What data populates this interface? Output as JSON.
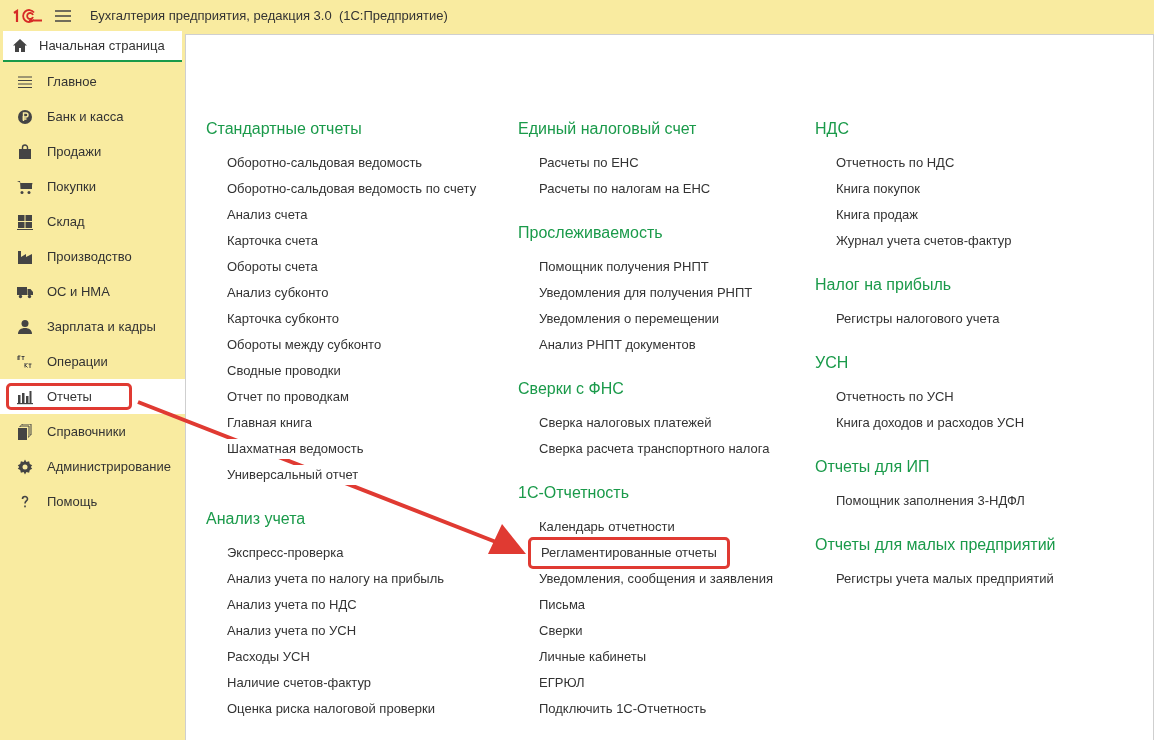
{
  "window": {
    "title": "Бухгалтерия предприятия, редакция 3.0  (1С:Предприятие)"
  },
  "home_tab": {
    "label": "Начальная страница",
    "selected": true
  },
  "sidebar": {
    "items": [
      {
        "label": "Главное",
        "selected": false,
        "highlighted": false
      },
      {
        "label": "Банк и касса",
        "selected": false,
        "highlighted": false
      },
      {
        "label": "Продажи",
        "selected": false,
        "highlighted": false
      },
      {
        "label": "Покупки",
        "selected": false,
        "highlighted": false
      },
      {
        "label": "Склад",
        "selected": false,
        "highlighted": false
      },
      {
        "label": "Производство",
        "selected": false,
        "highlighted": false
      },
      {
        "label": "ОС и НМА",
        "selected": false,
        "highlighted": false
      },
      {
        "label": "Зарплата и кадры",
        "selected": false,
        "highlighted": false
      },
      {
        "label": "Операции",
        "selected": false,
        "highlighted": false
      },
      {
        "label": "Отчеты",
        "selected": true,
        "highlighted": true
      },
      {
        "label": "Справочники",
        "selected": false,
        "highlighted": false
      },
      {
        "label": "Администрирование",
        "selected": false,
        "highlighted": false
      },
      {
        "label": "Помощь",
        "selected": false,
        "highlighted": false
      }
    ]
  },
  "columns": [
    [
      {
        "title": "Стандартные отчеты",
        "links": [
          {
            "label": "Оборотно-сальдовая ведомость",
            "highlighted": false
          },
          {
            "label": "Оборотно-сальдовая ведомость по счету",
            "highlighted": false
          },
          {
            "label": "Анализ счета",
            "highlighted": false
          },
          {
            "label": "Карточка счета",
            "highlighted": false
          },
          {
            "label": "Обороты счета",
            "highlighted": false
          },
          {
            "label": "Анализ субконто",
            "highlighted": false
          },
          {
            "label": "Карточка субконто",
            "highlighted": false
          },
          {
            "label": "Обороты между субконто",
            "highlighted": false
          },
          {
            "label": "Сводные проводки",
            "highlighted": false
          },
          {
            "label": "Отчет по проводкам",
            "highlighted": false
          },
          {
            "label": "Главная книга",
            "highlighted": false
          },
          {
            "label": "Шахматная ведомость",
            "highlighted": false
          },
          {
            "label": "Универсальный отчет",
            "highlighted": false
          }
        ]
      },
      {
        "title": "Анализ учета",
        "links": [
          {
            "label": "Экспресс-проверка",
            "highlighted": false
          },
          {
            "label": "Анализ учета по налогу на прибыль",
            "highlighted": false
          },
          {
            "label": "Анализ учета по НДС",
            "highlighted": false
          },
          {
            "label": "Анализ учета по УСН",
            "highlighted": false
          },
          {
            "label": "Расходы УСН",
            "highlighted": false
          },
          {
            "label": "Наличие счетов-фактур",
            "highlighted": false
          },
          {
            "label": "Оценка риска налоговой проверки",
            "highlighted": false
          }
        ]
      }
    ],
    [
      {
        "title": "Единый налоговый счет",
        "links": [
          {
            "label": "Расчеты по ЕНС",
            "highlighted": false
          },
          {
            "label": "Расчеты по налогам на ЕНС",
            "highlighted": false
          }
        ]
      },
      {
        "title": "Прослеживаемость",
        "links": [
          {
            "label": "Помощник получения РНПТ",
            "highlighted": false
          },
          {
            "label": "Уведомления для получения РНПТ",
            "highlighted": false
          },
          {
            "label": "Уведомления о перемещении",
            "highlighted": false
          },
          {
            "label": "Анализ РНПТ документов",
            "highlighted": false
          }
        ]
      },
      {
        "title": "Сверки с ФНС",
        "links": [
          {
            "label": "Сверка налоговых платежей",
            "highlighted": false
          },
          {
            "label": "Сверка расчета транспортного налога",
            "highlighted": false
          }
        ]
      },
      {
        "title": "1С-Отчетность",
        "links": [
          {
            "label": "Календарь отчетности",
            "highlighted": false
          },
          {
            "label": "Регламентированные отчеты",
            "highlighted": true
          },
          {
            "label": "Уведомления, сообщения и заявления",
            "highlighted": false
          },
          {
            "label": "Письма",
            "highlighted": false
          },
          {
            "label": "Сверки",
            "highlighted": false
          },
          {
            "label": "Личные кабинеты",
            "highlighted": false
          },
          {
            "label": "ЕГРЮЛ",
            "highlighted": false
          },
          {
            "label": "Подключить 1С-Отчетность",
            "highlighted": false
          }
        ]
      }
    ],
    [
      {
        "title": "НДС",
        "links": [
          {
            "label": "Отчетность по НДС",
            "highlighted": false
          },
          {
            "label": "Книга покупок",
            "highlighted": false
          },
          {
            "label": "Книга продаж",
            "highlighted": false
          },
          {
            "label": "Журнал учета счетов-фактур",
            "highlighted": false
          }
        ]
      },
      {
        "title": "Налог на прибыль",
        "links": [
          {
            "label": "Регистры налогового учета",
            "highlighted": false
          }
        ]
      },
      {
        "title": "УСН",
        "links": [
          {
            "label": "Отчетность по УСН",
            "highlighted": false
          },
          {
            "label": "Книга доходов и расходов УСН",
            "highlighted": false
          }
        ]
      },
      {
        "title": "Отчеты для ИП",
        "links": [
          {
            "label": "Помощник заполнения 3-НДФЛ",
            "highlighted": false
          }
        ]
      },
      {
        "title": "Отчеты для малых предприятий",
        "links": [
          {
            "label": "Регистры учета малых предприятий",
            "highlighted": false
          }
        ]
      }
    ]
  ]
}
